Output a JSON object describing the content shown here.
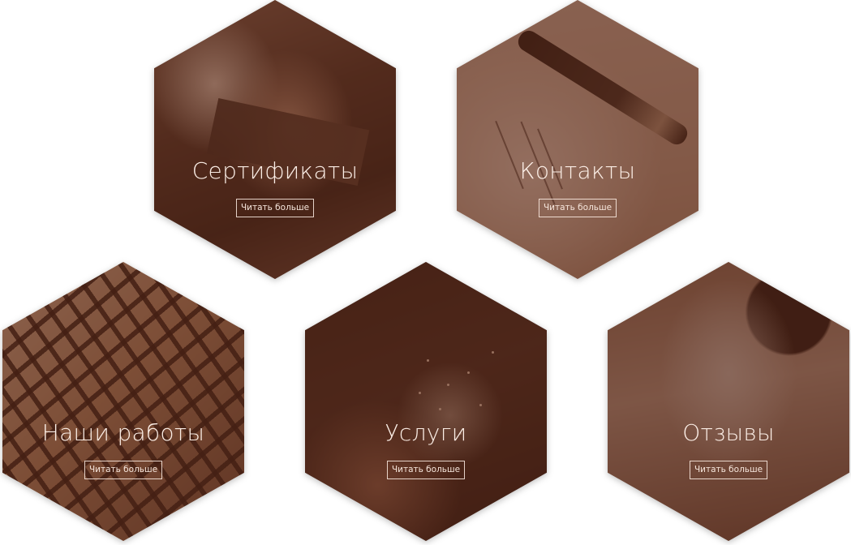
{
  "tiles": [
    {
      "title": "Сертификаты",
      "button": "Читать больше"
    },
    {
      "title": "Контакты",
      "button": "Читать больше"
    },
    {
      "title": "Наши работы",
      "button": "Читать больше"
    },
    {
      "title": "Услуги",
      "button": "Читать больше"
    },
    {
      "title": "Отзывы",
      "button": "Читать больше"
    }
  ],
  "colors": {
    "overlay": "#582616",
    "text": "#fbeee6",
    "background": "#ffffff"
  }
}
